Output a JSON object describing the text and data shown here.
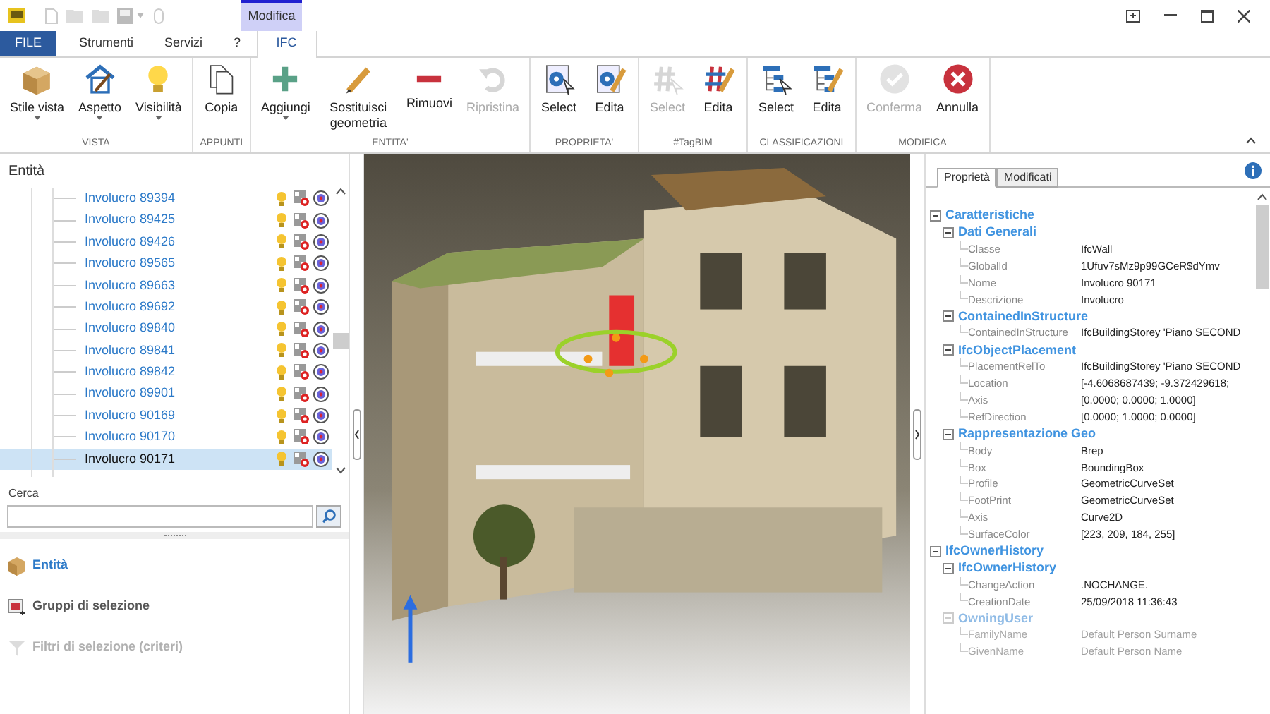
{
  "contextual_tab_group": {
    "label": "Modifica"
  },
  "menu_tabs": [
    {
      "label": "FILE",
      "kind": "file",
      "selected": false
    },
    {
      "label": "Strumenti",
      "kind": "tab",
      "selected": false
    },
    {
      "label": "Servizi",
      "kind": "tab",
      "selected": false
    },
    {
      "label": "?",
      "kind": "tab",
      "selected": false
    },
    {
      "label": "IFC",
      "kind": "contextual",
      "selected": true
    }
  ],
  "ribbon": {
    "groups": [
      {
        "label": "VISTA",
        "buttons": [
          {
            "label": "Stile vista",
            "kind": "box",
            "dropdown": true,
            "disabled": false
          },
          {
            "label": "Aspetto",
            "kind": "house",
            "dropdown": true,
            "disabled": false
          },
          {
            "label": "Visibilità",
            "kind": "bulb",
            "dropdown": true,
            "disabled": false
          }
        ]
      },
      {
        "label": "APPUNTI",
        "buttons": [
          {
            "label": "Copia",
            "kind": "copy",
            "dropdown": false,
            "disabled": false
          }
        ]
      },
      {
        "label": "ENTITA'",
        "buttons": [
          {
            "label": "Aggiungi",
            "kind": "plus",
            "dropdown": true,
            "disabled": false
          },
          {
            "label": "Sostituisci geometria",
            "kind": "pencil",
            "dropdown": false,
            "disabled": false
          },
          {
            "label": "Rimuovi",
            "kind": "minus",
            "dropdown": false,
            "disabled": false
          },
          {
            "label": "Ripristina",
            "kind": "undo",
            "dropdown": false,
            "disabled": true
          }
        ]
      },
      {
        "label": "PROPRIETA'",
        "buttons": [
          {
            "label": "Select",
            "kind": "gear-select",
            "dropdown": false,
            "disabled": false
          },
          {
            "label": "Edita",
            "kind": "gear-edit",
            "dropdown": false,
            "disabled": false
          }
        ]
      },
      {
        "label": "#TagBIM",
        "buttons": [
          {
            "label": "Select",
            "kind": "hash-select",
            "dropdown": false,
            "disabled": true
          },
          {
            "label": "Edita",
            "kind": "hash-edit",
            "dropdown": false,
            "disabled": false
          }
        ]
      },
      {
        "label": "CLASSIFICAZIONI",
        "buttons": [
          {
            "label": "Select",
            "kind": "tree-select",
            "dropdown": false,
            "disabled": false
          },
          {
            "label": "Edita",
            "kind": "tree-edit",
            "dropdown": false,
            "disabled": false
          }
        ]
      },
      {
        "label": "MODIFICA",
        "buttons": [
          {
            "label": "Conferma",
            "kind": "check",
            "dropdown": false,
            "disabled": true
          },
          {
            "label": "Annulla",
            "kind": "cancel",
            "dropdown": false,
            "disabled": false
          }
        ]
      }
    ]
  },
  "entities_panel": {
    "title": "Entità",
    "rows": [
      {
        "label": "Involucro 89394",
        "selected": false
      },
      {
        "label": "Involucro 89425",
        "selected": false
      },
      {
        "label": "Involucro 89426",
        "selected": false
      },
      {
        "label": "Involucro 89565",
        "selected": false
      },
      {
        "label": "Involucro 89663",
        "selected": false
      },
      {
        "label": "Involucro 89692",
        "selected": false
      },
      {
        "label": "Involucro 89840",
        "selected": false
      },
      {
        "label": "Involucro 89841",
        "selected": false
      },
      {
        "label": "Involucro 89842",
        "selected": false
      },
      {
        "label": "Involucro 89901",
        "selected": false
      },
      {
        "label": "Involucro 90169",
        "selected": false
      },
      {
        "label": "Involucro 90170",
        "selected": false
      },
      {
        "label": "Involucro 90171",
        "selected": true
      }
    ],
    "search": {
      "label": "Cerca"
    },
    "sections": [
      {
        "label": "Entità",
        "kind": "box",
        "selected": true,
        "disabled": false
      },
      {
        "label": "Gruppi di selezione",
        "kind": "group",
        "selected": false,
        "disabled": false
      },
      {
        "label": "Filtri di selezione (criteri)",
        "kind": "filter",
        "selected": false,
        "disabled": true
      }
    ]
  },
  "properties_panel": {
    "tabs": [
      {
        "label": "Proprietà",
        "selected": true
      },
      {
        "label": "Modificati",
        "selected": false
      }
    ],
    "tree": [
      {
        "label": "Caratteristiche",
        "expanded": true,
        "dimmed": false,
        "children": [
          {
            "label": "Dati Generali",
            "expanded": true,
            "dimmed": false,
            "children": [
              {
                "name": "Classe",
                "value": "IfcWall",
                "dimmed": false
              },
              {
                "name": "GlobalId",
                "value": "1Ufuv7sMz9p99GCeR$dYmv",
                "dimmed": false
              },
              {
                "name": "Nome",
                "value": "Involucro 90171",
                "dimmed": false
              },
              {
                "name": "Descrizione",
                "value": "Involucro",
                "dimmed": false
              }
            ]
          },
          {
            "label": "ContainedInStructure",
            "expanded": true,
            "dimmed": false,
            "children": [
              {
                "name": "ContainedInStructure",
                "value": "IfcBuildingStorey 'Piano SECOND",
                "dimmed": false
              }
            ]
          },
          {
            "label": "IfcObjectPlacement",
            "expanded": true,
            "dimmed": false,
            "children": [
              {
                "name": "PlacementRelTo",
                "value": "IfcBuildingStorey 'Piano SECOND",
                "dimmed": false
              },
              {
                "name": "Location",
                "value": "[-4.6068687439; -9.372429618;",
                "dimmed": false
              },
              {
                "name": "Axis",
                "value": "[0.0000; 0.0000; 1.0000]",
                "dimmed": false
              },
              {
                "name": "RefDirection",
                "value": "[0.0000; 1.0000; 0.0000]",
                "dimmed": false
              }
            ]
          },
          {
            "label": "Rappresentazione Geo",
            "expanded": true,
            "dimmed": false,
            "children": [
              {
                "name": "Body",
                "value": "Brep",
                "dimmed": false
              },
              {
                "name": "Box",
                "value": "BoundingBox",
                "dimmed": false
              },
              {
                "name": "Profile",
                "value": "GeometricCurveSet",
                "dimmed": false
              },
              {
                "name": "FootPrint",
                "value": "GeometricCurveSet",
                "dimmed": false
              },
              {
                "name": "Axis",
                "value": "Curve2D",
                "dimmed": false
              },
              {
                "name": "SurfaceColor",
                "value": "[223, 209, 184, 255]",
                "dimmed": false
              }
            ]
          }
        ]
      },
      {
        "label": "IfcOwnerHistory",
        "expanded": true,
        "dimmed": false,
        "children": [
          {
            "label": "IfcOwnerHistory",
            "expanded": true,
            "dimmed": false,
            "children": [
              {
                "name": "ChangeAction",
                "value": ".NOCHANGE.",
                "dimmed": false
              },
              {
                "name": "CreationDate",
                "value": "25/09/2018 11:36:43",
                "dimmed": false
              }
            ]
          },
          {
            "label": "OwningUser",
            "expanded": true,
            "dimmed": true,
            "children": [
              {
                "name": "FamilyName",
                "value": "Default Person Surname",
                "dimmed": true
              },
              {
                "name": "GivenName",
                "value": "Default Person Name",
                "dimmed": true
              }
            ]
          }
        ]
      }
    ]
  }
}
